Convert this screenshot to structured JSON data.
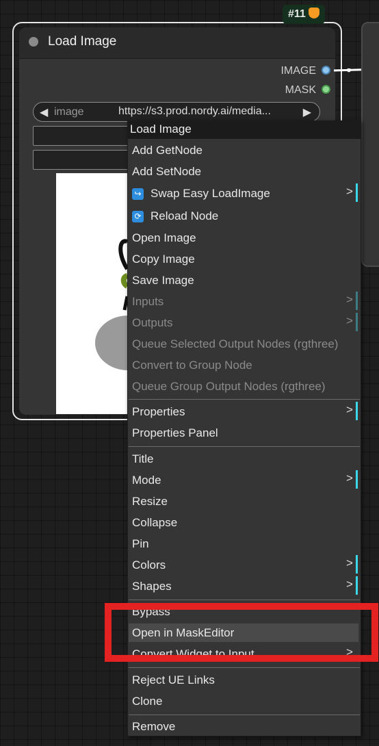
{
  "node": {
    "title": "Load Image",
    "badge": "#11",
    "outputs": {
      "image": "IMAGE",
      "mask": "MASK"
    },
    "image_widget": {
      "label": "image",
      "value": "https://s3.prod.nordy.ai/media...",
      "left_arrow": "◀",
      "right_arrow": "▶"
    }
  },
  "menu": {
    "title": "Load Image",
    "submenu_arrow": ">",
    "items": [
      {
        "label": "Add GetNode"
      },
      {
        "label": "Add SetNode"
      },
      {
        "label": "Swap Easy LoadImage",
        "icon": "↪"
      },
      {
        "label": "Reload Node",
        "icon": "⟳"
      },
      {
        "label": "Open Image"
      },
      {
        "label": "Copy Image"
      },
      {
        "label": "Save Image"
      },
      {
        "label": "Inputs"
      },
      {
        "label": "Outputs"
      },
      {
        "label": "Queue Selected Output Nodes (rgthree)"
      },
      {
        "label": "Convert to Group Node"
      },
      {
        "label": "Queue Group Output Nodes (rgthree)"
      },
      {
        "label": "Properties"
      },
      {
        "label": "Properties Panel"
      },
      {
        "label": "Title"
      },
      {
        "label": "Mode"
      },
      {
        "label": "Resize"
      },
      {
        "label": "Collapse"
      },
      {
        "label": "Pin"
      },
      {
        "label": "Colors"
      },
      {
        "label": "Shapes"
      },
      {
        "label": "Bypass"
      },
      {
        "label": "Open in MaskEditor"
      },
      {
        "label": "Convert Widget to Input"
      },
      {
        "label": "Reject UE Links"
      },
      {
        "label": "Clone"
      },
      {
        "label": "Remove"
      }
    ]
  },
  "colors": {
    "highlight_box": "#e52222",
    "submenu_indicator": "#3ad8e8",
    "image_output": "#8fc7f0",
    "mask_output": "#8cd98f"
  }
}
